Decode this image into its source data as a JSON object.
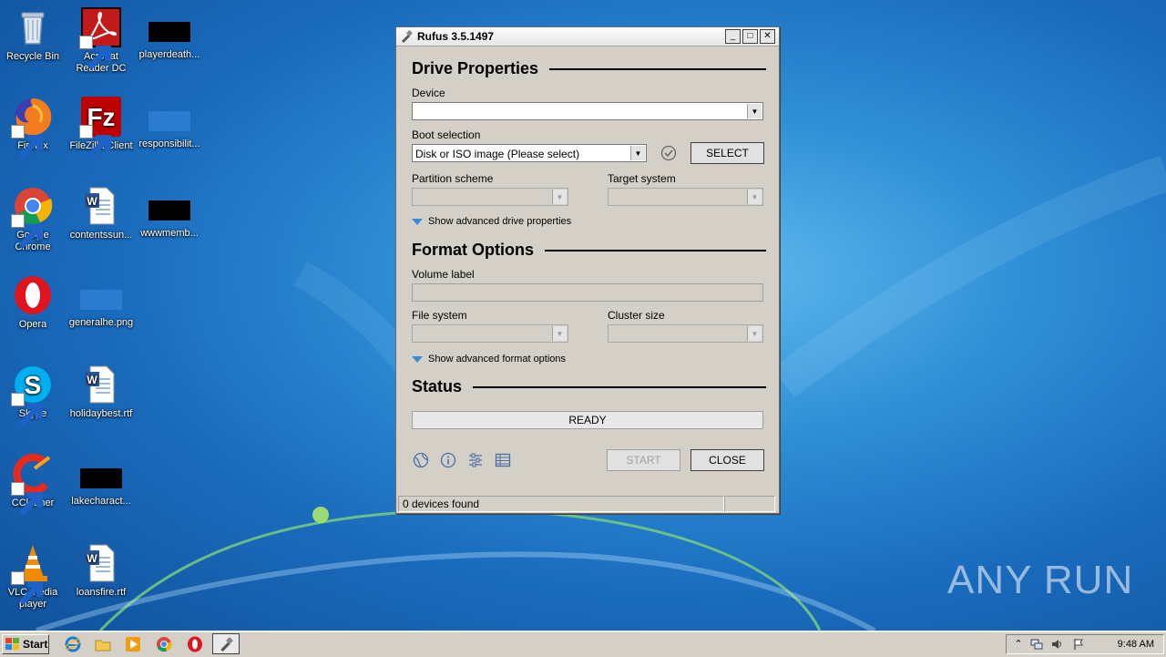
{
  "desktop": {
    "icons": [
      {
        "label": "Recycle Bin"
      },
      {
        "label": "Acrobat\nReader DC"
      },
      {
        "label": "playerdeath..."
      },
      {
        "label": "Firefox"
      },
      {
        "label": "FileZilla Client"
      },
      {
        "label": "responsibilit..."
      },
      {
        "label": "Google\nChrome"
      },
      {
        "label": "contentssun..."
      },
      {
        "label": "wwwmemb..."
      },
      {
        "label": "Opera"
      },
      {
        "label": "generalhe.png"
      },
      {
        "label": "Skype"
      },
      {
        "label": "holidaybest.rtf"
      },
      {
        "label": "CCleaner"
      },
      {
        "label": "lakecharact..."
      },
      {
        "label": "VLC media\nplayer"
      },
      {
        "label": "loansfire.rtf"
      }
    ],
    "watermark": "ANY RUN"
  },
  "window": {
    "title": "Rufus 3.5.1497",
    "drive_properties": {
      "heading": "Drive Properties",
      "device_label": "Device",
      "device_value": "",
      "boot_selection_label": "Boot selection",
      "boot_selection_value": "Disk or ISO image (Please select)",
      "select_button": "SELECT",
      "partition_scheme_label": "Partition scheme",
      "target_system_label": "Target system",
      "advanced_toggle": "Show advanced drive properties"
    },
    "format_options": {
      "heading": "Format Options",
      "volume_label_label": "Volume label",
      "file_system_label": "File system",
      "cluster_size_label": "Cluster size",
      "advanced_toggle": "Show advanced format options"
    },
    "status": {
      "heading": "Status",
      "progress_text": "READY"
    },
    "buttons": {
      "start": "START",
      "close": "CLOSE"
    },
    "statusbar": {
      "devices": "0 devices found",
      "extra": ""
    }
  },
  "taskbar": {
    "start_label": "Start",
    "clock": "9:48 AM"
  }
}
